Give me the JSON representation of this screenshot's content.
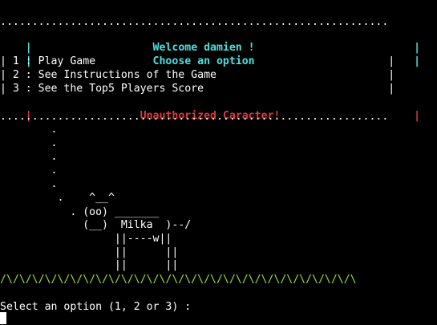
{
  "menu": {
    "border_top": ".............................................................",
    "border_bottom": ".............................................................",
    "welcome": "|                   Welcome damien !                         |",
    "choose": "|                   Choose an option                         |",
    "option_1": "| 1 : Play Game                                              |",
    "option_2": "| 2 : See Instructions of the Game                           |",
    "option_3": "| 3 : See the Top5 Players Score                             |",
    "error": "|                 Unauthorized Caracter!                     |"
  },
  "art": {
    "line_1": "        .",
    "line_2": "        .",
    "line_3": "        .",
    "line_4": "        .",
    "line_5": "        .",
    "line_6": "         .    ^__^",
    "line_7": "           . (oo) _______",
    "line_8": "             (__)  Milka  )--/",
    "line_9": "                  ||----w||",
    "line_10": "                  ||      ||",
    "line_11": "                  ||      ||",
    "grass": "/\\/\\/\\/\\/\\/\\/\\/\\/\\/\\/\\/\\/\\/\\/\\/\\/\\/\\/\\/\\/\\/\\/\\/\\/\\/\\/\\/\\"
  },
  "prompt": {
    "text": "Select an option (1, 2 or 3) :"
  },
  "colors": {
    "background": "#000000",
    "text": "#ffffff",
    "accent": "#4ee0e0",
    "error": "#e23a3a",
    "grass": "#9ee02c"
  }
}
